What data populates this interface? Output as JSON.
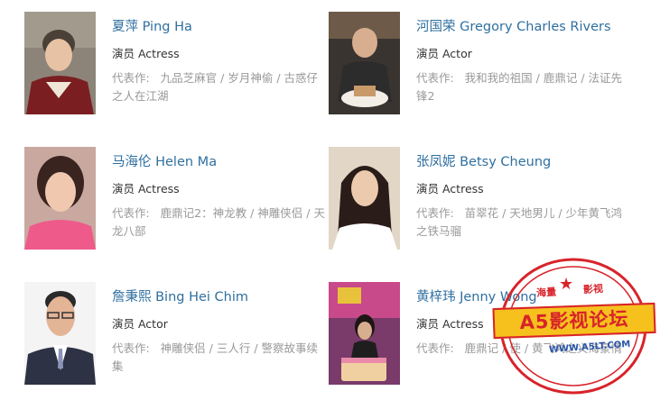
{
  "works_label": "代表作:",
  "people": [
    {
      "name": "夏萍 Ping Ha",
      "role": "演员 Actress",
      "works": [
        "九品芝麻官",
        "岁月神偷",
        "古惑仔之人在江湖"
      ],
      "photo": "portrait-elderly-woman"
    },
    {
      "name": "河国荣 Gregory Charles Rivers",
      "role": "演员 Actor",
      "works": [
        "我和我的祖国",
        "鹿鼎记",
        "法证先锋2"
      ],
      "photo": "portrait-man-with-cake"
    },
    {
      "name": "马海伦 Helen Ma",
      "role": "演员 Actress",
      "works": [
        "鹿鼎记2：神龙教",
        "神雕侠侣",
        "天龙八部"
      ],
      "photo": "portrait-young-woman-pink"
    },
    {
      "name": "张凤妮 Betsy Cheung",
      "role": "演员 Actress",
      "works": [
        "苗翠花",
        "天地男儿",
        "少年黄飞鸿之铁马骝"
      ],
      "photo": "portrait-woman-long-hair"
    },
    {
      "name": "詹秉熙 Bing Hei Chim",
      "role": "演员 Actor",
      "works": [
        "神雕侠侣",
        "三人行",
        "警察故事续集"
      ],
      "photo": "portrait-man-glasses-suit"
    },
    {
      "name": "黄梓玮 Jenny Wong",
      "role": "演员 Actress",
      "works": [
        "鹿鼎记",
        "使",
        "黄飞鸿之义海豪情"
      ],
      "photo": "portrait-woman-birthday-cake"
    }
  ],
  "watermark": {
    "banner": "A5影视论坛",
    "top_left": "海量",
    "top_right": "影视",
    "url": "WWW.A5LT.COM",
    "star": "★"
  },
  "colors": {
    "name_link": "#2f6f9f",
    "role_text": "#333333",
    "works_text": "#999999",
    "stamp_red": "#d8232a",
    "stamp_yellow": "#f6c11d",
    "stamp_blue": "#2a56a8"
  }
}
